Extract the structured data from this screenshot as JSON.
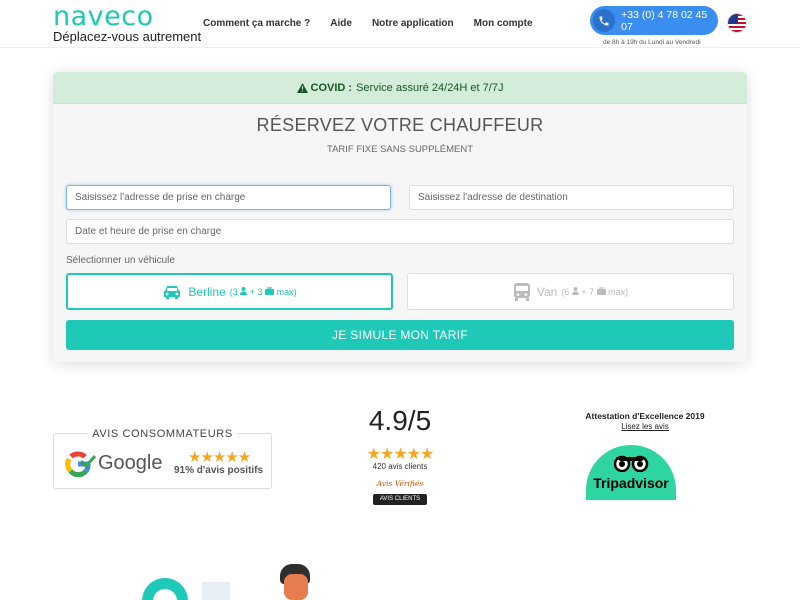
{
  "header": {
    "logo_word": "naveco",
    "logo_tagline": "Déplacez-vous autrement",
    "nav": [
      "Comment ça marche ?",
      "Aide",
      "Notre application",
      "Mon compte"
    ],
    "phone": "+33 (0) 4 78 02 45 07",
    "hours": "de 8h à 19h du Lundi au Vendredi"
  },
  "booking": {
    "alert_label": "COVID :",
    "alert_text": "Service assuré 24/24H et 7/7J",
    "title": "RÉSERVEZ VOTRE CHAUFFEUR",
    "subtitle": "TARIF FIXE SANS SUPPLÉMENT",
    "pickup_placeholder": "Saisissez l'adresse de prise en charge",
    "destination_placeholder": "Saisissez l'adresse de destination",
    "datetime_placeholder": "Date et heure de prise en charge",
    "vehicle_label": "Sélectionner un véhicule",
    "vehicles": [
      {
        "name": "Berline",
        "pax": "(3",
        "bags": "+ 3",
        "max": "max)"
      },
      {
        "name": "Van",
        "pax": "(6",
        "bags": "+ 7",
        "max": "max)"
      }
    ],
    "submit_label": "JE SIMULE MON TARIF"
  },
  "reviews": {
    "google_title": "AVIS CONSOMMATEURS",
    "google_word": "Google",
    "google_positive": "91% d'avis positifs",
    "score": "4.9/5",
    "count": "420 avis clients",
    "av_logo": "Avis Vérifiés",
    "av_badge": "AVIS CLIENTS",
    "trip_title": "Attestation d'Excellence 2019",
    "trip_link": "Lisez les avis",
    "trip_word": "Tripadvisor"
  },
  "colors": {
    "brand": "#1ec9b7",
    "phone": "#3a8ef0",
    "star": "#f5a623"
  }
}
